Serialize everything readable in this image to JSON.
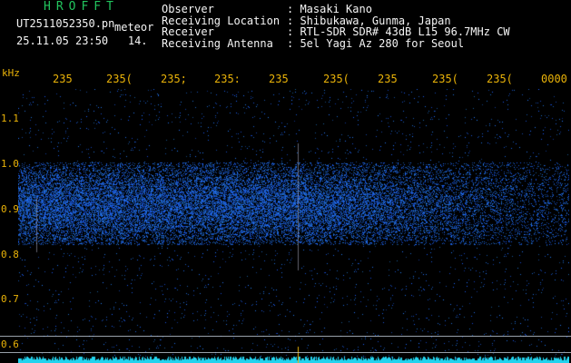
{
  "header": {
    "title": "HROFFT",
    "filename": "UT2511052350.pn",
    "filetype": "meteor",
    "datetime": "25.11.05 23:50",
    "count": "14.",
    "info": [
      {
        "key": "Observer",
        "value": ": Masaki Kano"
      },
      {
        "key": "Receiving Location",
        "value": ": Shibukawa, Gunma, Japan"
      },
      {
        "key": "Receiver",
        "value": ": RTL-SDR SDR# 43dB L15 96.7MHz CW"
      },
      {
        "key": "Receiving Antenna",
        "value": ": 5el Yagi Az 280 for Seoul"
      }
    ]
  },
  "axes": {
    "unit": "kHz",
    "x_ticks": [
      "235",
      "235(",
      "235;",
      "235:",
      "235",
      "235(",
      "235",
      "235(",
      "235(",
      "0000"
    ],
    "y_ticks": [
      "1.1",
      "1.0",
      "0.9",
      "0.8",
      "0.7",
      "0.6"
    ]
  },
  "colors": {
    "background": "#000000",
    "axis_text": "#eab308",
    "title": "#22c55e",
    "signal": "#3b82f6",
    "baseline": "#22d3ee"
  }
}
